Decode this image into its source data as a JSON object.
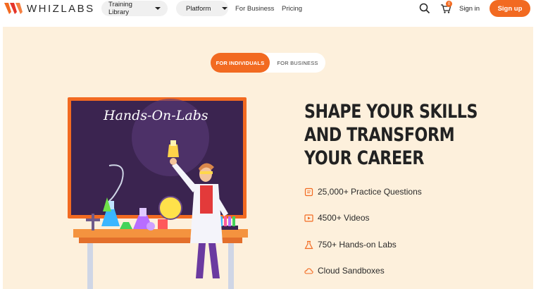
{
  "header": {
    "logo_text": "WHIZLABS",
    "nav": [
      {
        "label": "Training Library",
        "dropdown": true
      },
      {
        "label": "Platform",
        "dropdown": true
      }
    ],
    "links": [
      "For Business",
      "Pricing"
    ],
    "cart_count": "0",
    "signin_label": "Sign in",
    "signup_label": "Sign up"
  },
  "hero": {
    "toggle": {
      "active": "FOR INDIVIDUALS",
      "inactive": "FOR BUSINESS"
    },
    "board_title": "Hands-On-Labs",
    "headline": [
      "SHAPE YOUR SKILLS",
      "AND TRANSFORM",
      "YOUR CAREER"
    ],
    "features": [
      {
        "icon": "questions-icon",
        "label": "25,000+ Practice Questions"
      },
      {
        "icon": "video-icon",
        "label": "4500+ Videos"
      },
      {
        "icon": "lab-flask-icon",
        "label": "750+ Hands-on Labs"
      },
      {
        "icon": "cloud-icon",
        "label": "Cloud Sandboxes"
      }
    ]
  },
  "colors": {
    "accent": "#f26a21",
    "hero_bg": "#fdf0dc",
    "board": "#3b2450"
  }
}
